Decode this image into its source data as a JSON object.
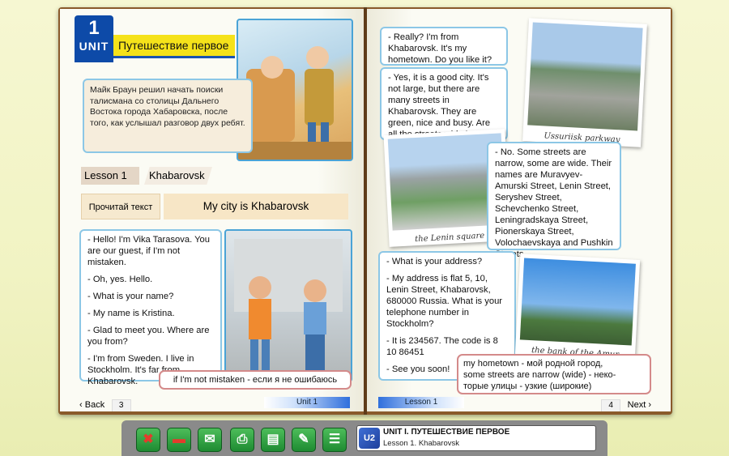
{
  "left_page": {
    "unit_number": "1",
    "unit_label": "UNIT",
    "unit_title": "Путешествие первое",
    "intro_text": "Майк Браун решил начать поиски талисмана со столицы Дальнего Востока города Хабаровска, после того, как услышал разговор двух ребят.",
    "lesson_number": "Lesson 1",
    "lesson_name": "Khabarovsk",
    "read_label": "Прочитай текст",
    "text_title": "My city is Khabarovsk",
    "dialog": [
      "- Hello! I'm Vika Tarasova. You are our guest, if I'm not mistaken.",
      "- Oh, yes. Hello.",
      "- What is your name?",
      "- My name is Kristina.",
      "- Glad to meet you. Where are you from?",
      "- I'm from Sweden. I live in Stockholm. It's far from Khabarovsk."
    ],
    "gloss": "if I'm not mistaken - если я не ошибаюсь",
    "back_label": "Back",
    "page_number": "3",
    "unit_tag": "Unit 1"
  },
  "right_page": {
    "dialog1": "- Really? I'm from Khabarovsk. It's my hometown. Do you like it?",
    "dialog2": "- Yes, it is a good city. It's not large, but there are many streets in Khabarovsk. They are green, nice and busy. Are all the streets wide in your town?",
    "dialog3": "- No. Some streets are narrow, some are wide. Their names are Muravyev-Amurski Street, Lenin Street, Seryshev Street, Schevchenko Street, Leningradskaya Street, Pionerskaya Street, Volochaevskaya and Pushkin Streets.",
    "dialog4": [
      "- What is your address?",
      "- My address is flat 5, 10, Lenin Street, Khabarovsk, 680000 Russia. What is your telephone number in Stockholm?",
      "- It is 234567. The code is 8 10 86451",
      "- See you soon!"
    ],
    "photo_captions": [
      "Ussuriisk parkway",
      "the Lenin square",
      "the bank of the Amur"
    ],
    "gloss_lines": [
      "my hometown - мой родной город,",
      "some streets are narrow (wide) - неко-",
      "торые улицы - узкие (широкие)"
    ],
    "lesson_tag": "Lesson 1",
    "page_number": "4",
    "next_label": "Next"
  },
  "toolbar": {
    "info_title": "UNIT I. ПУТЕШЕСТВИЕ ПЕРВОЕ",
    "info_subtitle": "Lesson 1. Khabarovsk",
    "icons": [
      "close-icon",
      "minus-icon",
      "chat-icon",
      "print-icon",
      "book-icon",
      "dictionary-icon",
      "notes-icon"
    ]
  }
}
